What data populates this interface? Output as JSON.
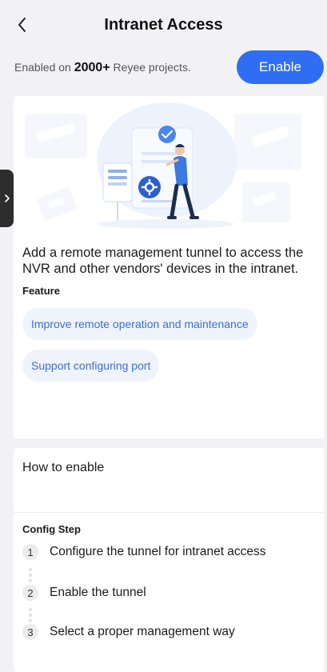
{
  "header": {
    "title": "Intranet Access",
    "back_icon": "chevron-left-icon"
  },
  "banner": {
    "prefix": "Enabled on ",
    "count": "2000+",
    "suffix": " Reyee projects.",
    "enable_label": "Enable"
  },
  "intro": {
    "description": "Add a remote management tunnel to access the NVR and other vendors' devices in the intranet.",
    "feature_heading": "Feature",
    "features": [
      "Improve remote operation and maintenance",
      "Support configuring port"
    ]
  },
  "how": {
    "title": "How to enable",
    "config_heading": "Config Step",
    "steps": [
      {
        "num": "1",
        "text": "Configure the tunnel for intranet access"
      },
      {
        "num": "2",
        "text": "Enable the tunnel"
      },
      {
        "num": "3",
        "text": "Select a proper management way"
      }
    ]
  },
  "colors": {
    "accent": "#2f6ef2",
    "chip_bg": "#eef3fc",
    "chip_text": "#3d6fd6",
    "page_bg": "#f2f2f4"
  }
}
